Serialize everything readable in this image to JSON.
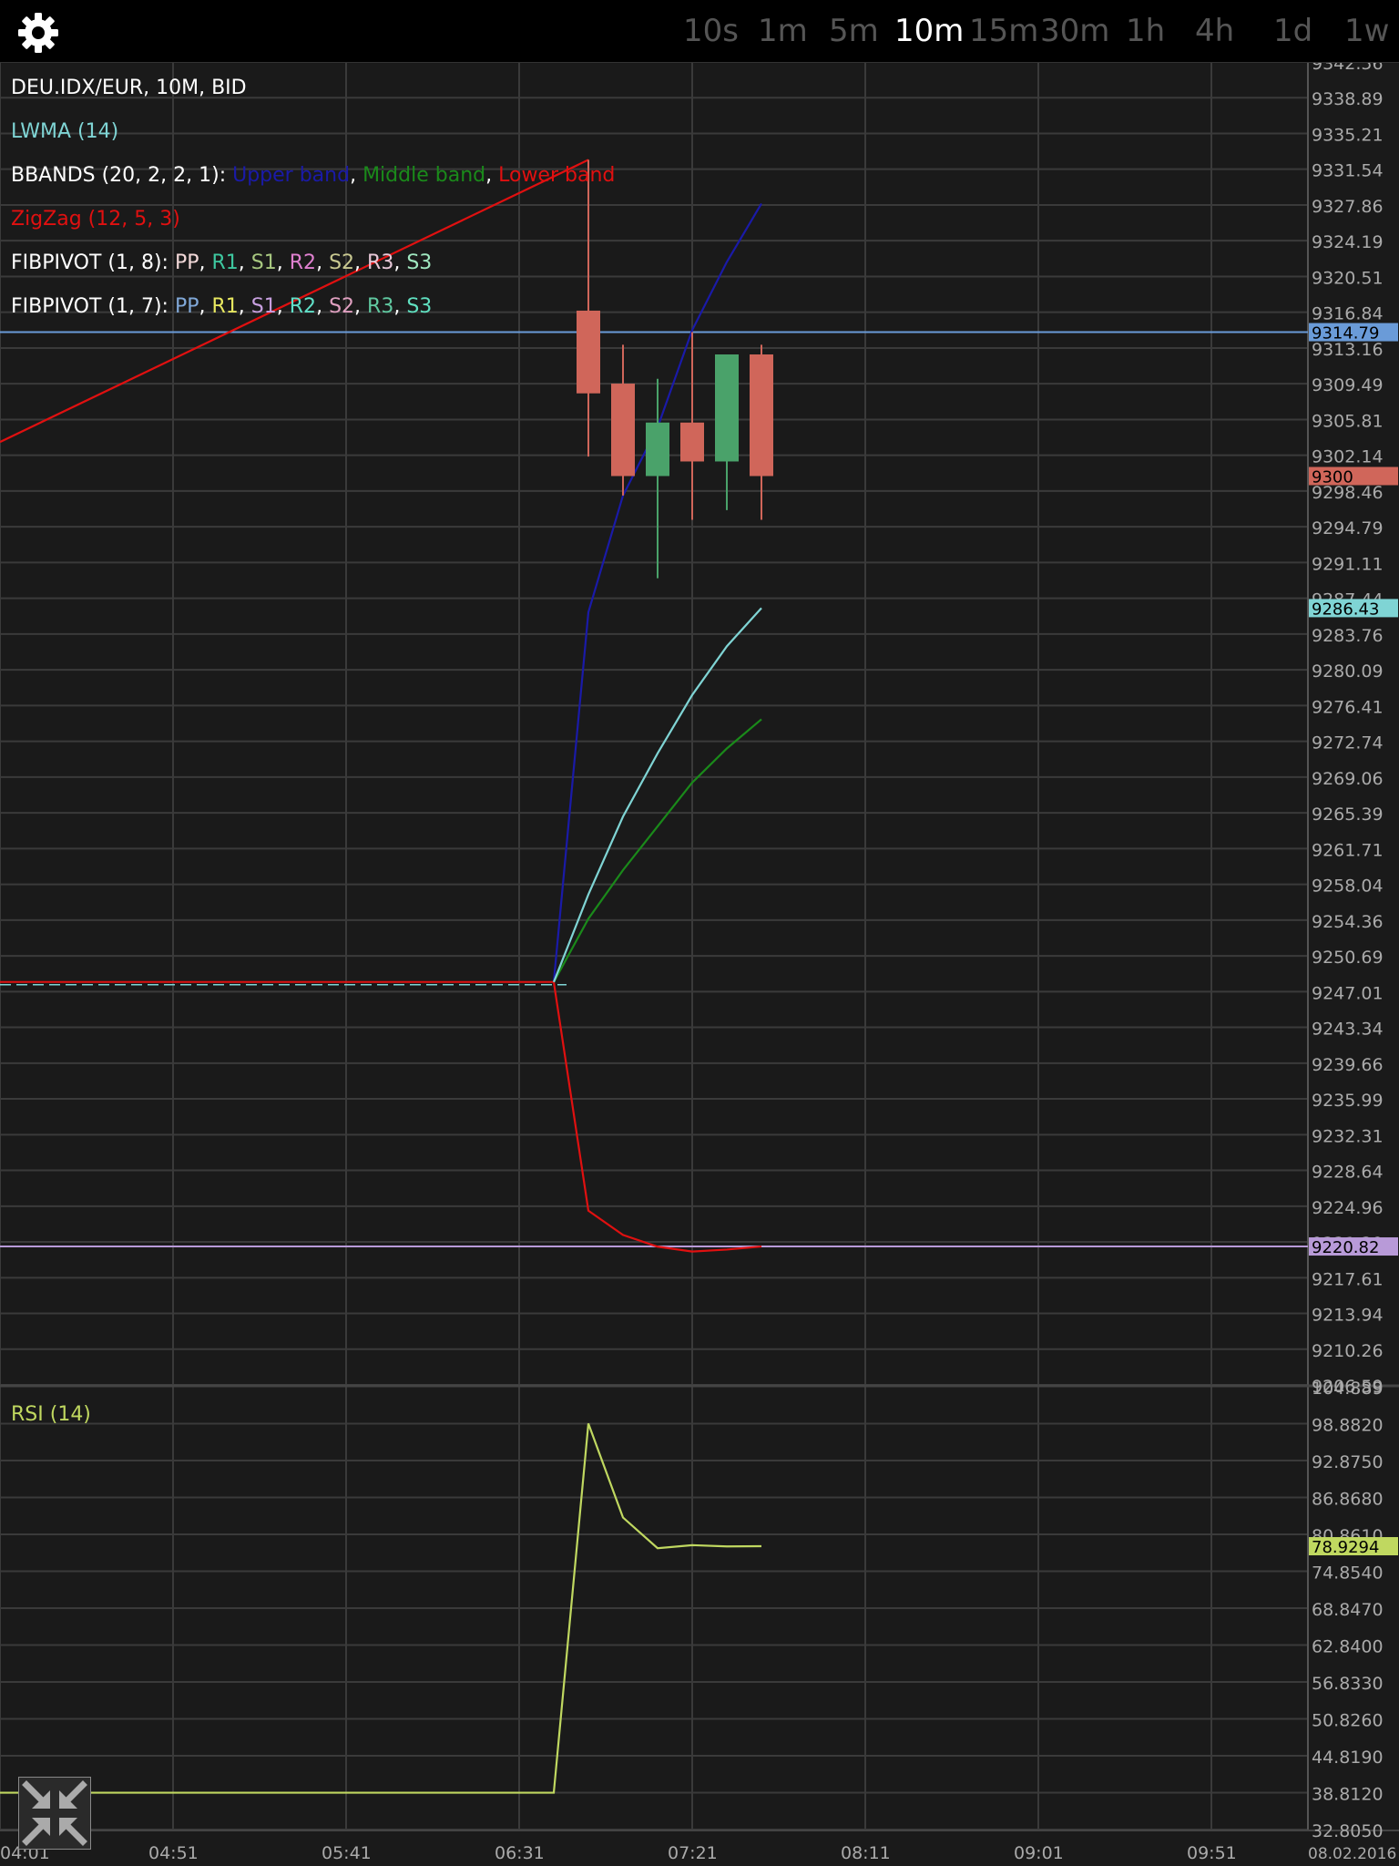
{
  "toolbar": {
    "settings_icon": "gear-icon",
    "timeframes": [
      "10s",
      "1m",
      "5m",
      "10m",
      "15m",
      "30m",
      "1h",
      "4h",
      "1d",
      "1w"
    ],
    "active_timeframe": "10m"
  },
  "overlays": {
    "instrument": "DEU.IDX/EUR, 10M, BID",
    "lwma": "LWMA (14)",
    "bbands": {
      "prefix": "BBANDS (20, 2, 2, 1): ",
      "upper": "Upper band",
      "middle": "Middle band",
      "lower": "Lower band",
      "sep": ", "
    },
    "zigzag": "ZigZag (12, 5, 3)",
    "fib8": {
      "prefix": "FIBPIVOT (1, 8): ",
      "items": [
        "PP",
        "R1",
        "S1",
        "R2",
        "S2",
        "R3",
        "S3"
      ]
    },
    "fib7": {
      "prefix": "FIBPIVOT (1, 7): ",
      "items": [
        "PP",
        "R1",
        "S1",
        "R2",
        "S2",
        "R3",
        "S3"
      ]
    },
    "rsi": "RSI (14)"
  },
  "colors": {
    "background": "#1a1a1a",
    "grid": "#3a3a3a",
    "lwma": "#7fd4d4",
    "upper_band": "#1a1aa8",
    "middle_band": "#1a8a1a",
    "lower_band": "#e01010",
    "zigzag": "#e01010",
    "bull": "#4aa26a",
    "bear": "#d0665a",
    "rsi": "#c0d860",
    "fib8": [
      "#f2d8d8",
      "#3ec8a0",
      "#a8c880",
      "#e080d0",
      "#c8c890",
      "#e8c8d8",
      "#a0e8c0"
    ],
    "fib7": [
      "#80a8d8",
      "#e8e860",
      "#c8a0e0",
      "#60e0c8",
      "#e0a0c0",
      "#60c8a0",
      "#60e0c0"
    ]
  },
  "price_axis": {
    "labels": [
      "9342.56",
      "9338.89",
      "9335.21",
      "9331.54",
      "9327.86",
      "9324.19",
      "9320.51",
      "9316.84",
      "9313.16",
      "9309.49",
      "9305.81",
      "9302.14",
      "9298.46",
      "9294.79",
      "9291.11",
      "9287.44",
      "9283.76",
      "9280.09",
      "9276.41",
      "9272.74",
      "9269.06",
      "9265.39",
      "9261.71",
      "9258.04",
      "9254.36",
      "9250.69",
      "9247.01",
      "9243.34",
      "9239.66",
      "9235.99",
      "9232.31",
      "9228.64",
      "9224.96",
      "9221.29",
      "9217.61",
      "9213.94",
      "9210.26",
      "9206.59"
    ],
    "markers": [
      {
        "value": "9314.79",
        "color": "#6a9bd8"
      },
      {
        "value": "9300",
        "color": "#d0665a"
      },
      {
        "value": "9286.43",
        "color": "#7fd4d4"
      },
      {
        "value": "9220.82",
        "color": "#b89ad8"
      }
    ]
  },
  "rsi_axis": {
    "labels": [
      "104.889",
      "98.8820",
      "92.8750",
      "86.8680",
      "80.8610",
      "74.8540",
      "68.8470",
      "62.8400",
      "56.8330",
      "50.8260",
      "44.8190",
      "38.8120",
      "32.8050"
    ],
    "marker": {
      "value": "78.9294",
      "color": "#c0d860"
    }
  },
  "time_axis": {
    "labels": [
      "04:01",
      "04:51",
      "05:41",
      "06:31",
      "07:21",
      "08:11",
      "09:01",
      "09:51"
    ],
    "date": "08.02.2016"
  },
  "chart_data": {
    "type": "candlestick",
    "instrument": "DEU.IDX/EUR",
    "timeframe": "10M",
    "candles": [
      {
        "time": "06:51",
        "open": 9317.0,
        "high": 9332.5,
        "low": 9302.0,
        "close": 9308.5
      },
      {
        "time": "07:01",
        "open": 9309.5,
        "high": 9313.5,
        "low": 9298.0,
        "close": 9300.0
      },
      {
        "time": "07:11",
        "open": 9300.0,
        "high": 9310.0,
        "low": 9289.5,
        "close": 9305.5
      },
      {
        "time": "07:21",
        "open": 9305.5,
        "high": 9314.8,
        "low": 9295.5,
        "close": 9301.5
      },
      {
        "time": "07:31",
        "open": 9301.5,
        "high": 9312.5,
        "low": 9296.5,
        "close": 9312.5
      },
      {
        "time": "07:41",
        "open": 9312.5,
        "high": 9313.5,
        "low": 9295.5,
        "close": 9300.0
      }
    ],
    "series": [
      {
        "name": "Upper band",
        "x": [
          "06:41",
          "06:51",
          "07:01",
          "07:11",
          "07:21",
          "07:31",
          "07:41"
        ],
        "values": [
          9248.0,
          9286.0,
          9298.0,
          9305.0,
          9315.0,
          9322.0,
          9328.0
        ]
      },
      {
        "name": "Middle band",
        "x": [
          "06:41",
          "06:51",
          "07:01",
          "07:11",
          "07:21",
          "07:31",
          "07:41"
        ],
        "values": [
          9248.0,
          9254.5,
          9259.5,
          9264.0,
          9268.5,
          9272.0,
          9275.0
        ]
      },
      {
        "name": "Lower band",
        "x": [
          "06:41",
          "06:51",
          "07:01",
          "07:11",
          "07:21",
          "07:31",
          "07:41"
        ],
        "values": [
          9248.0,
          9224.5,
          9222.0,
          9220.8,
          9220.3,
          9220.5,
          9220.82
        ]
      },
      {
        "name": "LWMA (14)",
        "x": [
          "06:41",
          "06:51",
          "07:01",
          "07:11",
          "07:21",
          "07:31",
          "07:41"
        ],
        "values": [
          9248.0,
          9257.0,
          9265.0,
          9271.5,
          9277.5,
          9282.5,
          9286.43
        ]
      },
      {
        "name": "ZigZag (12, 5, 3)",
        "x": [
          "04:01",
          "06:51"
        ],
        "values": [
          9303.5,
          9332.5
        ]
      }
    ],
    "flat_line_before_0641": 9248.0,
    "pivot_lines": [
      9314.79,
      9220.82
    ],
    "last_price": 9300,
    "rsi": {
      "name": "RSI (14)",
      "x": [
        "04:01",
        "06:41",
        "06:51",
        "07:01",
        "07:11",
        "07:21",
        "07:31",
        "07:41"
      ],
      "values": [
        38.8,
        38.8,
        98.9,
        83.6,
        78.6,
        79.1,
        78.9,
        78.9294
      ]
    },
    "price_range": [
      9206.59,
      9342.56
    ],
    "rsi_range": [
      32.805,
      104.889
    ]
  }
}
